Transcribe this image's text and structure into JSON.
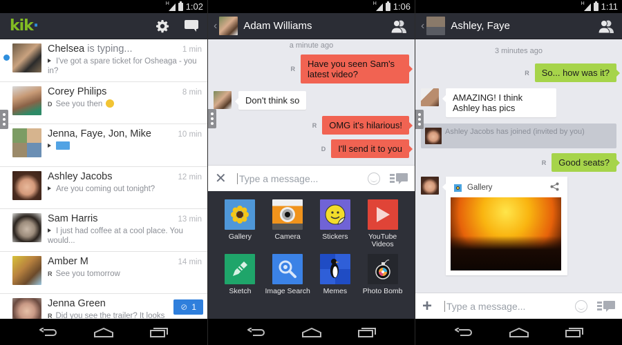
{
  "colors": {
    "kik_green": "#82bc23",
    "kik_blue": "#2f8fdd",
    "out_bubble_red": "#f16352",
    "out_bubble_green": "#a6d44a",
    "appbar": "#2b2d35",
    "chat_bg": "#e8e9ee",
    "badge_blue": "#2f7fdc"
  },
  "screen1": {
    "status_time": "1:02",
    "network": "H",
    "logo_text": "kik",
    "icons": [
      "gear-icon",
      "compose-chat-icon"
    ],
    "conversations": [
      {
        "name": "Chelsea",
        "status": " is typing...",
        "time": "1 min",
        "preview": "I've got a spare ticket for Osheaga - you in?",
        "indicator": "arrow",
        "unread": true
      },
      {
        "name": "Corey Philips",
        "time": "8 min",
        "preview": "See you then",
        "indicator": "D",
        "emoji": true
      },
      {
        "name": "Jenna, Faye, Jon, Mike",
        "time": "10 min",
        "preview": "",
        "indicator": "arrow",
        "sticker": true
      },
      {
        "name": "Ashley Jacobs",
        "time": "12 min",
        "preview": "Are you coming out tonight?",
        "indicator": "arrow"
      },
      {
        "name": "Sam Harris",
        "time": "13 min",
        "preview": "I just had coffee at a cool place. You would...",
        "indicator": "arrow"
      },
      {
        "name": "Amber M",
        "time": "14 min",
        "preview": "See you tomorrow",
        "indicator": "R"
      },
      {
        "name": "Jenna Green",
        "time": "",
        "preview": "Did you see the trailer? It looks",
        "indicator": "R",
        "badge_count": "1"
      }
    ]
  },
  "screen2": {
    "status_time": "1:06",
    "network": "H",
    "contact_name": "Adam Williams",
    "timestamp": "a minute ago",
    "messages": [
      {
        "dir": "out",
        "receipt": "R",
        "text": "Have you seen Sam's latest video?"
      },
      {
        "dir": "in",
        "text": "Don't think so"
      },
      {
        "dir": "out",
        "receipt": "R",
        "text": "OMG it's hilarious!"
      },
      {
        "dir": "out",
        "receipt": "D",
        "text": "I'll send it to you"
      }
    ],
    "input_placeholder": "Type a message...",
    "tray_items": [
      {
        "label": "Gallery",
        "icon": "gallery-icon"
      },
      {
        "label": "Camera",
        "icon": "camera-icon"
      },
      {
        "label": "Stickers",
        "icon": "stickers-icon"
      },
      {
        "label": "YouTube Videos",
        "icon": "youtube-icon"
      },
      {
        "label": "Sketch",
        "icon": "sketch-icon"
      },
      {
        "label": "Image Search",
        "icon": "image-search-icon"
      },
      {
        "label": "Memes",
        "icon": "memes-icon"
      },
      {
        "label": "Photo Bomb",
        "icon": "photo-bomb-icon"
      }
    ]
  },
  "screen3": {
    "status_time": "1:11",
    "network": "H",
    "group_name": "Ashley, Faye",
    "timestamp": "3 minutes ago",
    "messages": [
      {
        "dir": "out",
        "receipt": "R",
        "text": "So... how was it?"
      },
      {
        "dir": "in",
        "text": "AMAZING! I think Ashley has pics"
      },
      {
        "dir": "system",
        "text": "Ashley Jacobs has joined (invited by you)"
      },
      {
        "dir": "out",
        "receipt": "R",
        "text": "Good seats?"
      }
    ],
    "gallery_card": {
      "title": "Gallery"
    },
    "input_placeholder": "Type a message..."
  }
}
